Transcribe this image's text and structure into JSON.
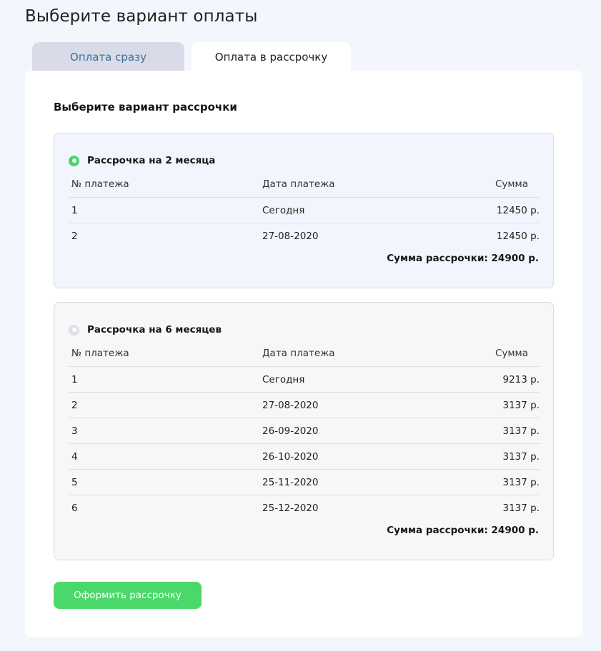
{
  "page": {
    "title": "Выберите вариант оплаты"
  },
  "tabs": [
    {
      "label": "Оплата сразу",
      "active": false
    },
    {
      "label": "Оплата в рассрочку",
      "active": true
    }
  ],
  "section": {
    "title": "Выберите вариант рассрочки"
  },
  "columns": {
    "num": "№ платежа",
    "date": "Дата платежа",
    "sum": "Сумма"
  },
  "plans": [
    {
      "name": "Рассрочка на 2 месяца",
      "selected": true,
      "rows": [
        {
          "num": "1",
          "date": "Сегодня",
          "sum": "12450 р."
        },
        {
          "num": "2",
          "date": "27-08-2020",
          "sum": "12450 р."
        }
      ],
      "total": "Сумма рассрочки: 24900 р."
    },
    {
      "name": "Рассрочка на 6 месяцев",
      "selected": false,
      "rows": [
        {
          "num": "1",
          "date": "Сегодня",
          "sum": "9213 р."
        },
        {
          "num": "2",
          "date": "27-08-2020",
          "sum": "3137 р."
        },
        {
          "num": "3",
          "date": "26-09-2020",
          "sum": "3137 р."
        },
        {
          "num": "4",
          "date": "26-10-2020",
          "sum": "3137 р."
        },
        {
          "num": "5",
          "date": "25-11-2020",
          "sum": "3137 р."
        },
        {
          "num": "6",
          "date": "25-12-2020",
          "sum": "3137 р."
        }
      ],
      "total": "Сумма рассрочки: 24900 р."
    }
  ],
  "submit": {
    "label": "Оформить рассрочку"
  },
  "colors": {
    "accent_green": "#4bd86b",
    "tab_inactive_bg": "#d9dce8",
    "tab_inactive_text": "#3c6f95",
    "page_bg": "#f4f6fd"
  },
  "icons": {
    "radio_selected": "radio-checked-icon",
    "radio_unselected": "radio-unchecked-icon"
  }
}
